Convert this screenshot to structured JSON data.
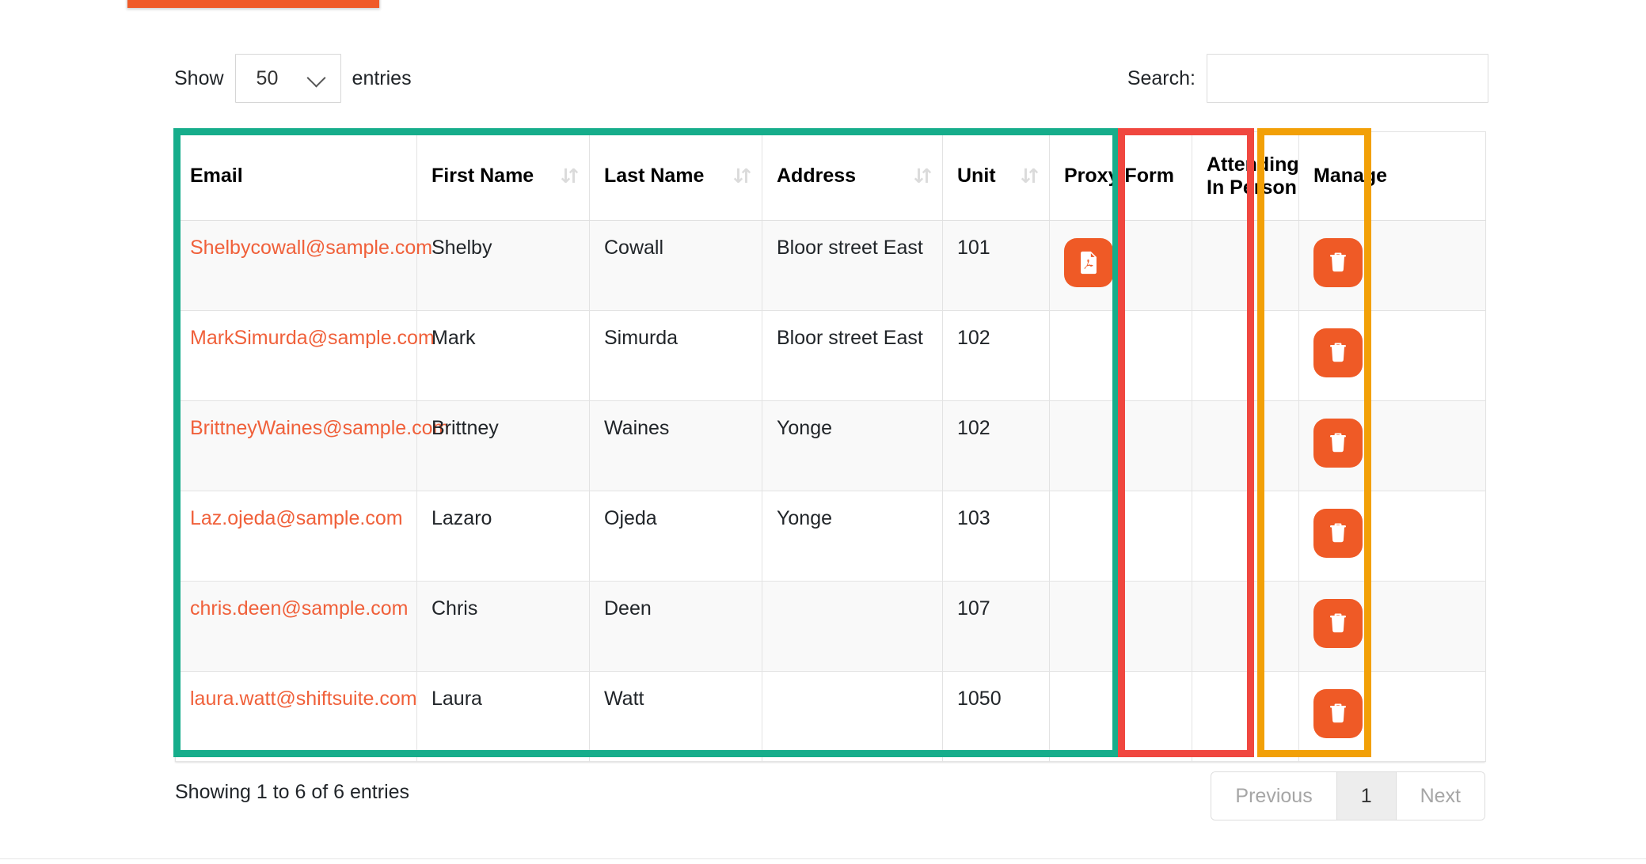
{
  "tab_strip": {
    "active_tab_color": "#f05a28"
  },
  "controls": {
    "show_label": "Show",
    "entries_label": "entries",
    "page_length_value": "50",
    "search_label": "Search:",
    "search_value": "",
    "search_placeholder": ""
  },
  "table": {
    "columns": [
      {
        "label": "Email",
        "sortable": false
      },
      {
        "label": "First Name",
        "sortable": true
      },
      {
        "label": "Last Name",
        "sortable": true
      },
      {
        "label": "Address",
        "sortable": true
      },
      {
        "label": "Unit",
        "sortable": true
      },
      {
        "label": "Proxy Form",
        "sortable": false
      },
      {
        "label": "Attending In Person",
        "sortable": false
      },
      {
        "label": "Manage",
        "sortable": false
      }
    ],
    "rows": [
      {
        "email": "Shelbycowall@sample.com",
        "first_name": "Shelby",
        "last_name": "Cowall",
        "address": "Bloor street East",
        "unit": "101",
        "proxy_form": "pdf-file-icon",
        "attending_in_person": "",
        "manage": "delete-icon"
      },
      {
        "email": "MarkSimurda@sample.com",
        "first_name": "Mark",
        "last_name": "Simurda",
        "address": "Bloor street East",
        "unit": "102",
        "proxy_form": "",
        "attending_in_person": "",
        "manage": "delete-icon"
      },
      {
        "email": "BrittneyWaines@sample.com",
        "first_name": "Brittney",
        "last_name": "Waines",
        "address": "Yonge",
        "unit": "102",
        "proxy_form": "",
        "attending_in_person": "",
        "manage": "delete-icon"
      },
      {
        "email": "Laz.ojeda@sample.com",
        "first_name": "Lazaro",
        "last_name": "Ojeda",
        "address": "Yonge",
        "unit": "103",
        "proxy_form": "",
        "attending_in_person": "",
        "manage": "delete-icon"
      },
      {
        "email": "chris.deen@sample.com",
        "first_name": "Chris",
        "last_name": "Deen",
        "address": "",
        "unit": "107",
        "proxy_form": "",
        "attending_in_person": "",
        "manage": "delete-icon"
      },
      {
        "email": "laura.watt@shiftsuite.com",
        "first_name": "Laura",
        "last_name": "Watt",
        "address": "",
        "unit": "1050",
        "proxy_form": "",
        "attending_in_person": "",
        "manage": "delete-icon"
      }
    ]
  },
  "footer": {
    "info": "Showing 1 to 6 of 6 entries",
    "pagination": {
      "previous_label": "Previous",
      "current_page_label": "1",
      "next_label": "Next"
    }
  },
  "highlights": [
    {
      "name": "email-to-unit-columns",
      "color": "#16ad8b"
    },
    {
      "name": "proxy-form-column",
      "color": "#f0473f"
    },
    {
      "name": "attending-in-person-column",
      "color": "#f2a007"
    }
  ],
  "colors": {
    "accent_orange": "#ef5a26",
    "link_orange": "#f0603a",
    "highlight_teal": "#16ad8b",
    "highlight_red": "#f0473f",
    "highlight_amber": "#f2a007"
  }
}
